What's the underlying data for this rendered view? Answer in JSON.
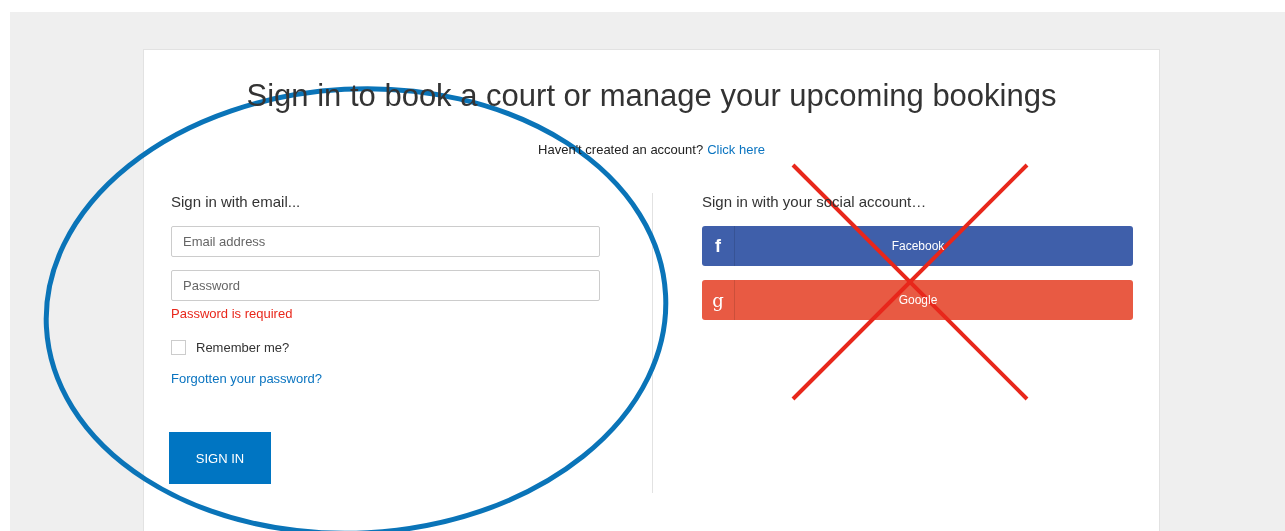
{
  "title": "Sign in to book a court or manage your upcoming bookings",
  "register": {
    "text": "Haven't created an account?",
    "link": "Click here"
  },
  "email_form": {
    "heading": "Sign in with email...",
    "fields": [
      {
        "placeholder": "Email address"
      },
      {
        "placeholder": "Password",
        "error": "Password is required"
      }
    ],
    "remember": {
      "label": "Remember me?",
      "checked": false
    },
    "forgot_link": "Forgotten your password?",
    "submit": "SIGN IN"
  },
  "social": {
    "heading": "Sign in with your social account…",
    "buttons": [
      {
        "kind": "facebook",
        "icon": "f",
        "label": "Facebook",
        "color": "#3f5faa"
      },
      {
        "kind": "google",
        "icon": "g",
        "label": "Google",
        "color": "#e85a43"
      }
    ]
  },
  "annotations": [
    {
      "kind": "ellipse",
      "color": "#0a74b8"
    },
    {
      "kind": "cross",
      "color": "#e8271b"
    }
  ]
}
